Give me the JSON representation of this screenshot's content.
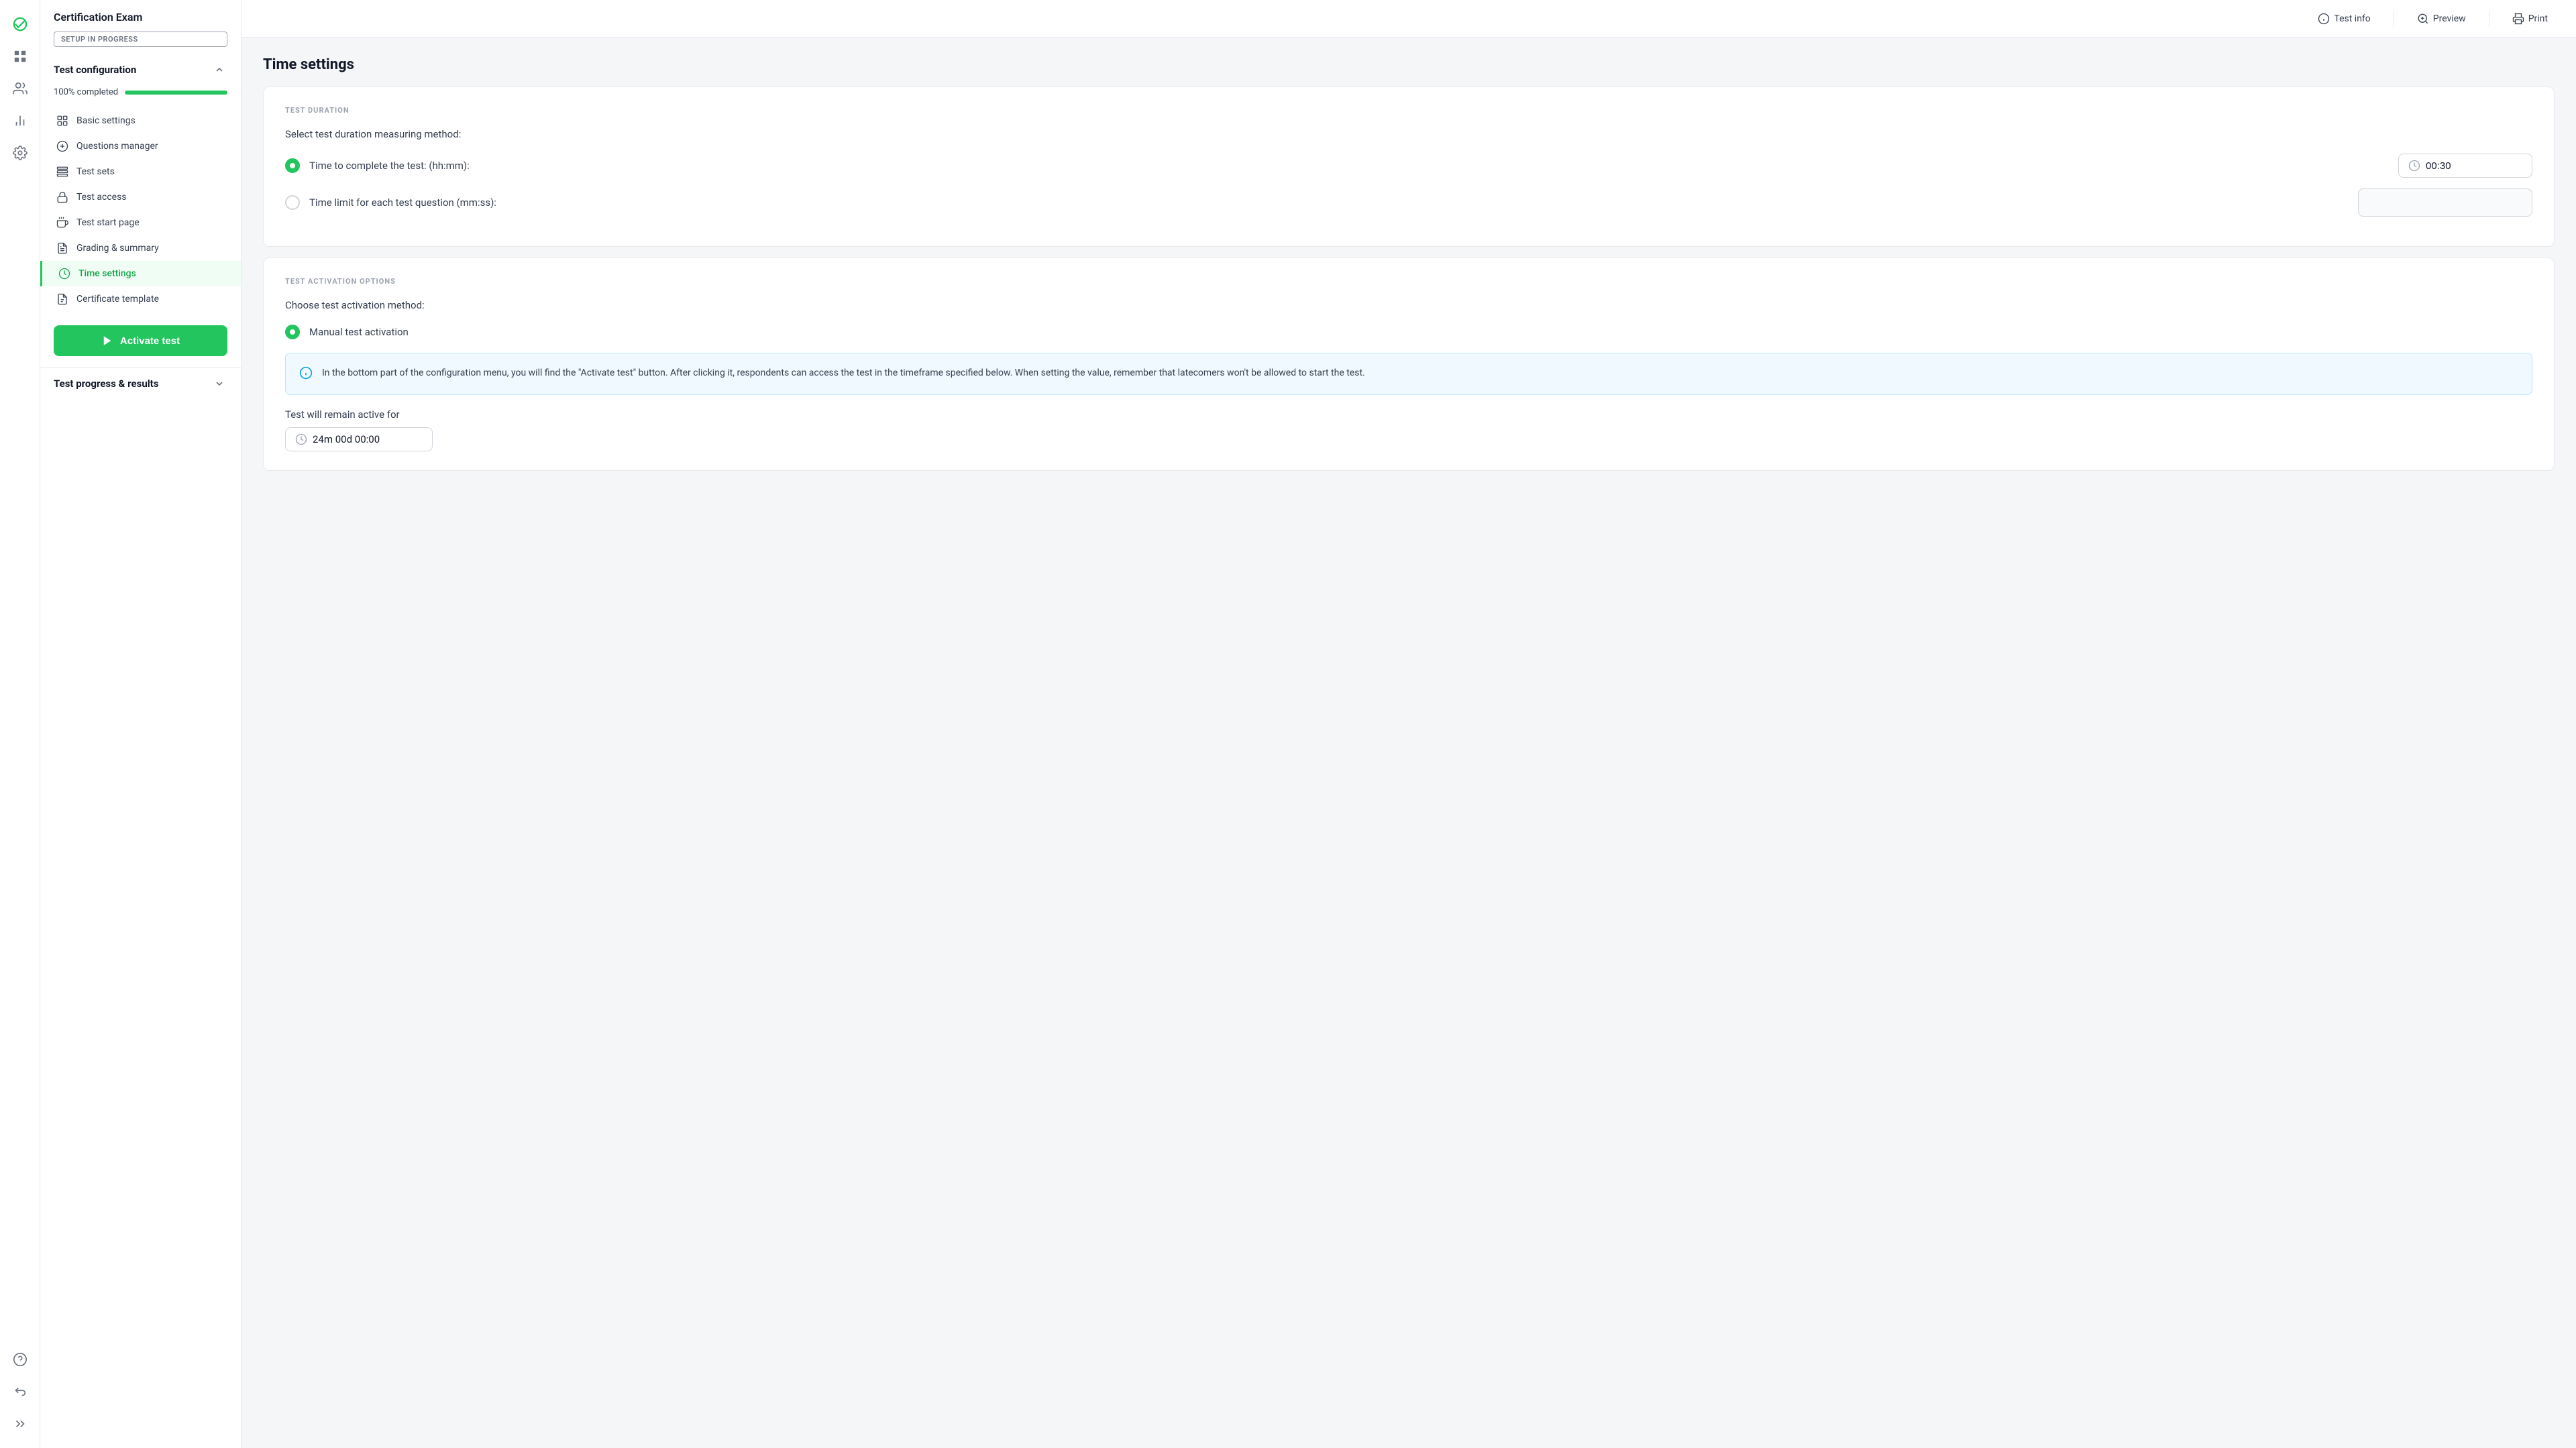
{
  "app": {
    "title": "Certification Exam"
  },
  "topbar": {
    "test_info": "Test info",
    "preview": "Preview",
    "print": "Print"
  },
  "status_badge": "SETUP IN PROGRESS",
  "sidebar": {
    "section1_title": "Test configuration",
    "progress_label": "100% completed",
    "progress_value": 100,
    "nav_items": [
      {
        "id": "basic-settings",
        "label": "Basic settings",
        "active": false
      },
      {
        "id": "questions-manager",
        "label": "Questions manager",
        "active": false
      },
      {
        "id": "test-sets",
        "label": "Test sets",
        "active": false
      },
      {
        "id": "test-access",
        "label": "Test access",
        "active": false
      },
      {
        "id": "test-start-page",
        "label": "Test start page",
        "active": false
      },
      {
        "id": "grading-summary",
        "label": "Grading & summary",
        "active": false
      },
      {
        "id": "time-settings",
        "label": "Time settings",
        "active": true
      },
      {
        "id": "certificate-template",
        "label": "Certificate template",
        "active": false
      }
    ],
    "activate_btn": "Activate test",
    "section2_title": "Test progress & results"
  },
  "main": {
    "page_title": "Time settings",
    "test_duration_section": "TEST DURATION",
    "duration_select_label": "Select test duration measuring method:",
    "option1_label": "Time to complete the test: (hh:mm):",
    "option1_value": "00:30",
    "option2_label": "Time limit for each test question (mm:ss):",
    "test_activation_section": "TEST ACTIVATION OPTIONS",
    "activation_select_label": "Choose test activation method:",
    "manual_activation_label": "Manual test activation",
    "info_text": "In the bottom part of the configuration menu, you will find the \"Activate test\" button. After clicking it, respondents can access the test in the timeframe specified below. When setting the value, remember that latecomers won't be allowed to start the test.",
    "remain_active_label": "Test will remain active for",
    "remain_active_value": "24m 00d 00:00"
  }
}
